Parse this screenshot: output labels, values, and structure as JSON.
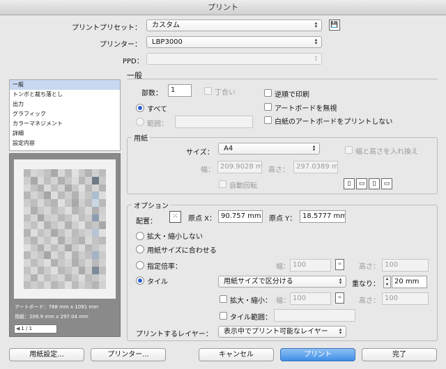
{
  "window": {
    "title": "プリント"
  },
  "header": {
    "preset_label": "プリントプリセット：",
    "preset_value": "カスタム",
    "printer_label": "プリンター：",
    "printer_value": "LBP3000",
    "ppd_label": "PPD：",
    "ppd_value": ""
  },
  "sidebar": {
    "items": [
      {
        "label": "一般",
        "selected": true
      },
      {
        "label": "トンボと裁ち落とし"
      },
      {
        "label": "出力"
      },
      {
        "label": "グラフィック"
      },
      {
        "label": "カラーマネジメント"
      },
      {
        "label": "詳細"
      },
      {
        "label": "設定内容"
      }
    ],
    "artboard_info": "アートボード：788 mm x 1091 mm",
    "paper_info": "用紙：209.9 mm x 297.04 mm",
    "page_nav": "1 / 1"
  },
  "general": {
    "section_title": "一般",
    "copies_label": "部数：",
    "copies_value": "1",
    "collate_label": "丁合い",
    "reverse_label": "逆順で印刷",
    "ignore_artboards_label": "アートボードを無視",
    "skip_blank_label": "白紙のアートボードをプリントしない",
    "all_label": "すべて",
    "range_label": "範囲：",
    "range_value": ""
  },
  "paper": {
    "section_title": "用紙",
    "size_label": "サイズ：",
    "size_value": "A4",
    "swap_label": "幅と高さを入れ換え",
    "width_label": "幅：",
    "width_value": "209.9028 m",
    "height_label": "高さ：",
    "height_value": "297.0389 m",
    "auto_rotate_label": "自動回転"
  },
  "options": {
    "section_title": "オプション",
    "placement_label": "配置：",
    "origin_x_label": "原点 X：",
    "origin_x_value": "90.757 mm",
    "origin_y_label": "原点 Y：",
    "origin_y_value": "18.5777 mm",
    "no_scale_label": "拡大・縮小しない",
    "fit_label": "用紙サイズに合わせる",
    "custom_scale_label": "指定倍率：",
    "tile_label": "タイル",
    "scale_width_label": "幅：",
    "scale_width_value": "100",
    "scale_height_label": "高さ：",
    "scale_height_value": "100",
    "tile_mode_value": "用紙サイズで区分ける",
    "overlap_label": "重なり：",
    "overlap_value": "20 mm",
    "tile_scale_label": "拡大・縮小：",
    "tile_width_label": "幅：",
    "tile_width_value": "100",
    "tile_height_label": "高さ：",
    "tile_height_value": "100",
    "tile_range_label": "タイル範囲：",
    "tile_range_value": "",
    "layers_label": "プリントするレイヤー：",
    "layers_value": "表示中でプリント可能なレイヤー"
  },
  "footer": {
    "page_setup": "用紙設定...",
    "printer": "プリンター...",
    "cancel": "キャンセル",
    "print": "プリント",
    "done": "完了"
  },
  "colors": {
    "accent": "#3f8ee8",
    "selection": "#c8d8f0"
  }
}
